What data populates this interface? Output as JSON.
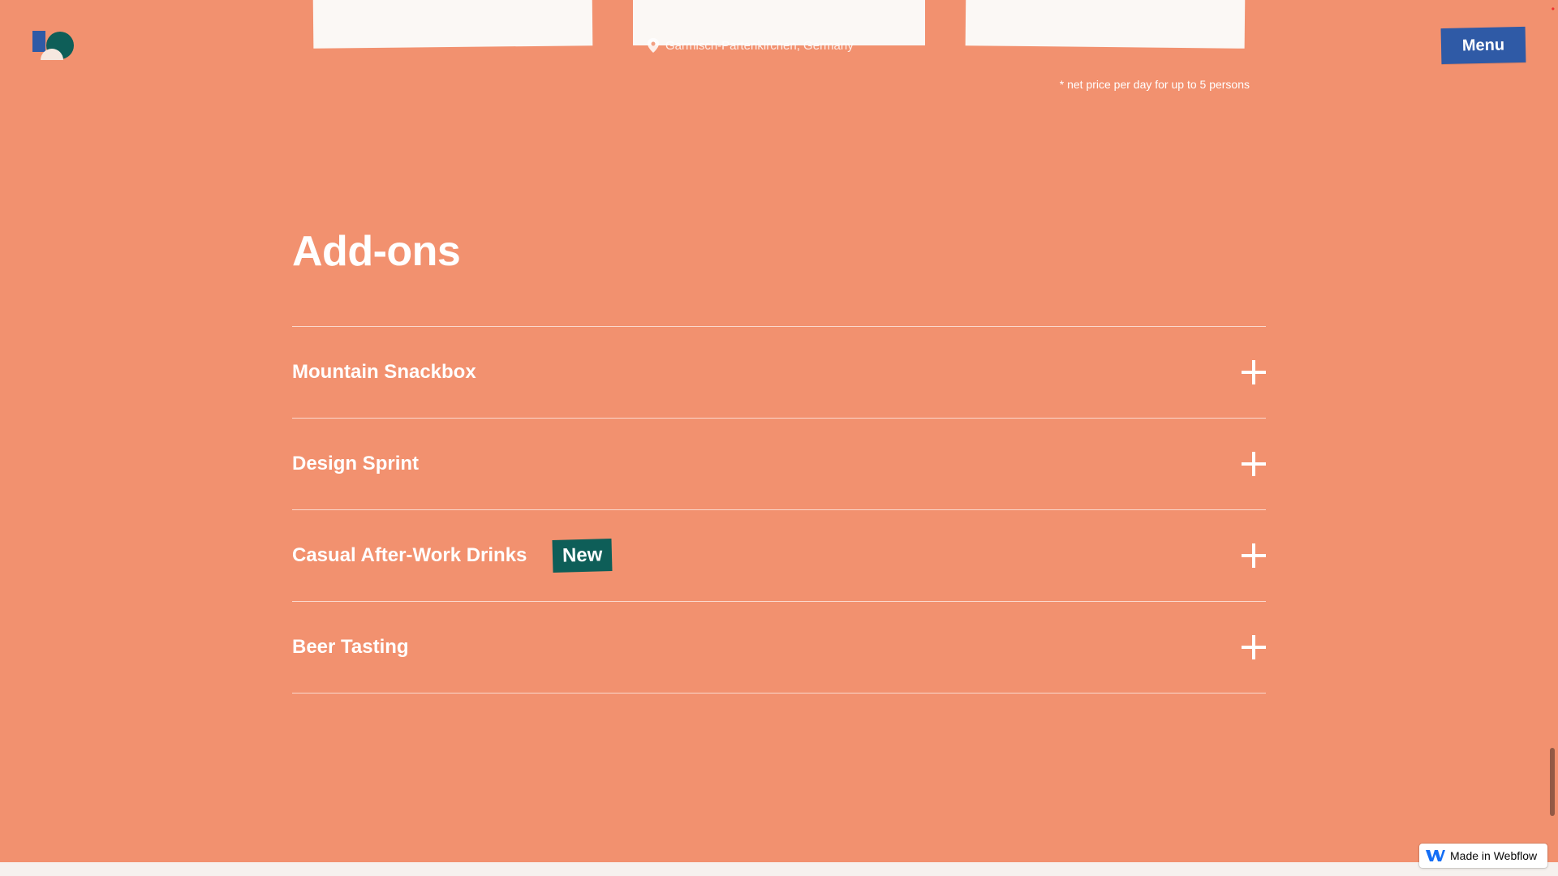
{
  "header": {
    "menu_label": "Menu"
  },
  "top_cards": {
    "location": "Garmisch-Partenkirchen, Germany",
    "price_note": "* net price per day for up to 5 persons"
  },
  "addons": {
    "title": "Add-ons",
    "items": [
      {
        "label": "Mountain Snackbox",
        "badge": ""
      },
      {
        "label": "Design Sprint",
        "badge": ""
      },
      {
        "label": "Casual After-Work Drinks",
        "badge": "New"
      },
      {
        "label": "Beer Tasting",
        "badge": ""
      }
    ]
  },
  "footer": {
    "webflow_label": "Made in Webflow"
  },
  "colors": {
    "background": "#f2916f",
    "menu_button": "#2f5aa6",
    "badge": "#0e5e58",
    "card": "#fbf8f5"
  },
  "icons": {
    "logo": "brand-logo",
    "location": "map-pin-icon",
    "expand": "plus-icon",
    "webflow": "webflow-icon"
  }
}
